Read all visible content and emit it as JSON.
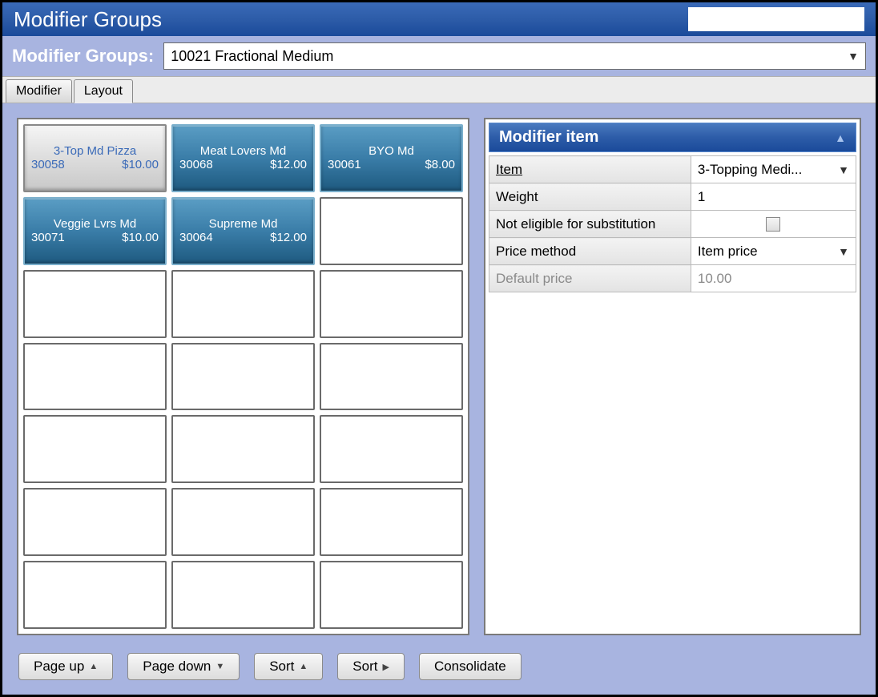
{
  "title": "Modifier Groups",
  "selector": {
    "label": "Modifier Groups:",
    "value": "10021 Fractional Medium"
  },
  "tabs": {
    "modifier": "Modifier",
    "layout": "Layout"
  },
  "grid": {
    "items": [
      {
        "name": "3-Top Md Pizza",
        "id": "30058",
        "price": "$10.00",
        "selected": true
      },
      {
        "name": "Meat Lovers Md",
        "id": "30068",
        "price": "$12.00",
        "selected": false
      },
      {
        "name": "BYO Md",
        "id": "30061",
        "price": "$8.00",
        "selected": false
      },
      {
        "name": "Veggie Lvrs Md",
        "id": "30071",
        "price": "$10.00",
        "selected": false
      },
      {
        "name": "Supreme Md",
        "id": "30064",
        "price": "$12.00",
        "selected": false
      }
    ]
  },
  "properties": {
    "header": "Modifier item",
    "rows": {
      "item_label": "Item",
      "item_value": "3-Topping Medi...",
      "weight_label": "Weight",
      "weight_value": "1",
      "nosub_label": "Not eligible for substitution",
      "pricemethod_label": "Price method",
      "pricemethod_value": "Item price",
      "defaultprice_label": "Default price",
      "defaultprice_value": "10.00"
    }
  },
  "footer": {
    "pageup": "Page up",
    "pagedown": "Page down",
    "sort_up": "Sort",
    "sort_right": "Sort",
    "consolidate": "Consolidate"
  }
}
